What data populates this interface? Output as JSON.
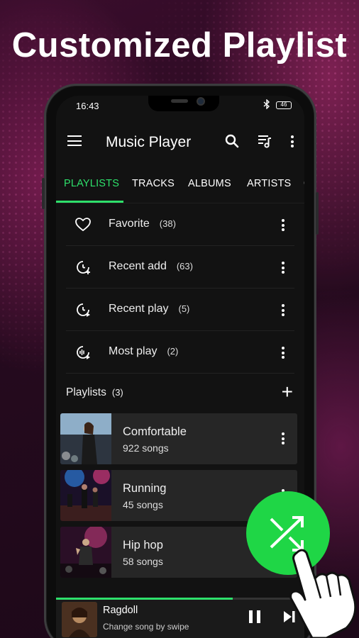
{
  "headline": "Customized Playlist",
  "status": {
    "time": "16:43",
    "battery": "46",
    "bluetooth_icon": "bluetooth-icon"
  },
  "appbar": {
    "title": "Music Player",
    "icons": [
      "menu-icon",
      "search-icon",
      "queue-icon",
      "more-vert-icon"
    ]
  },
  "tabs": [
    {
      "label": "PLAYLISTS",
      "active": true
    },
    {
      "label": "TRACKS"
    },
    {
      "label": "ALBUMS"
    },
    {
      "label": "ARTISTS"
    },
    {
      "label": "G"
    }
  ],
  "smart_lists": [
    {
      "label": "Favorite",
      "count": "(38)",
      "icon": "heart-icon"
    },
    {
      "label": "Recent add",
      "count": "(63)",
      "icon": "clock-add-icon"
    },
    {
      "label": "Recent play",
      "count": "(5)",
      "icon": "clock-play-icon"
    },
    {
      "label": "Most play",
      "count": "(2)",
      "icon": "audio-wave-icon"
    }
  ],
  "playlists_header": {
    "label": "Playlists",
    "count": "(3)"
  },
  "playlists": [
    {
      "title": "Comfortable",
      "subtitle": "922 songs"
    },
    {
      "title": "Running",
      "subtitle": "45 songs"
    },
    {
      "title": "Hip hop",
      "subtitle": "58 songs"
    }
  ],
  "now_playing": {
    "song": "Ragdoll",
    "hint": "Change song by swipe",
    "progress": 0.71
  },
  "colors": {
    "accent": "#2ee06b",
    "fab": "#1fd646",
    "background": "#121212",
    "card": "#262626"
  }
}
